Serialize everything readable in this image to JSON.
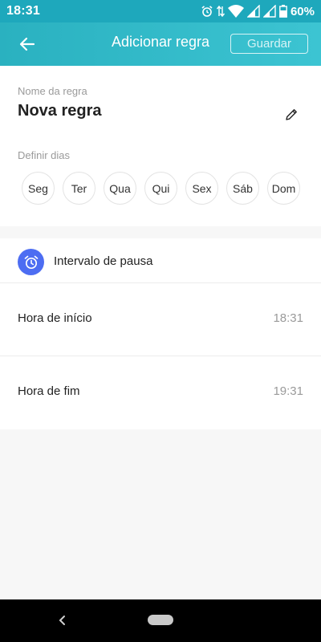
{
  "status_bar": {
    "time": "18:31",
    "battery": "60%"
  },
  "app_bar": {
    "title": "Adicionar regra",
    "save_label": "Guardar"
  },
  "rule": {
    "name_label": "Nome da regra",
    "name_value": "Nova regra",
    "days_label": "Definir dias",
    "days": [
      "Seg",
      "Ter",
      "Qua",
      "Qui",
      "Sex",
      "Sáb",
      "Dom"
    ]
  },
  "pause": {
    "title": "Intervalo de pausa",
    "start_label": "Hora de início",
    "start_value": "18:31",
    "end_label": "Hora de fim",
    "end_value": "19:31"
  },
  "icons": {
    "back": "arrow-left-icon",
    "edit": "pencil-icon",
    "section": "alarm-clock-icon",
    "status": [
      "alarm-icon",
      "data-arrows-icon",
      "wifi-icon",
      "signal-icon",
      "signal-no-data-icon",
      "battery-icon"
    ]
  },
  "colors": {
    "accent": "#2ab1c0",
    "icon_bg": "#4d6df2"
  }
}
